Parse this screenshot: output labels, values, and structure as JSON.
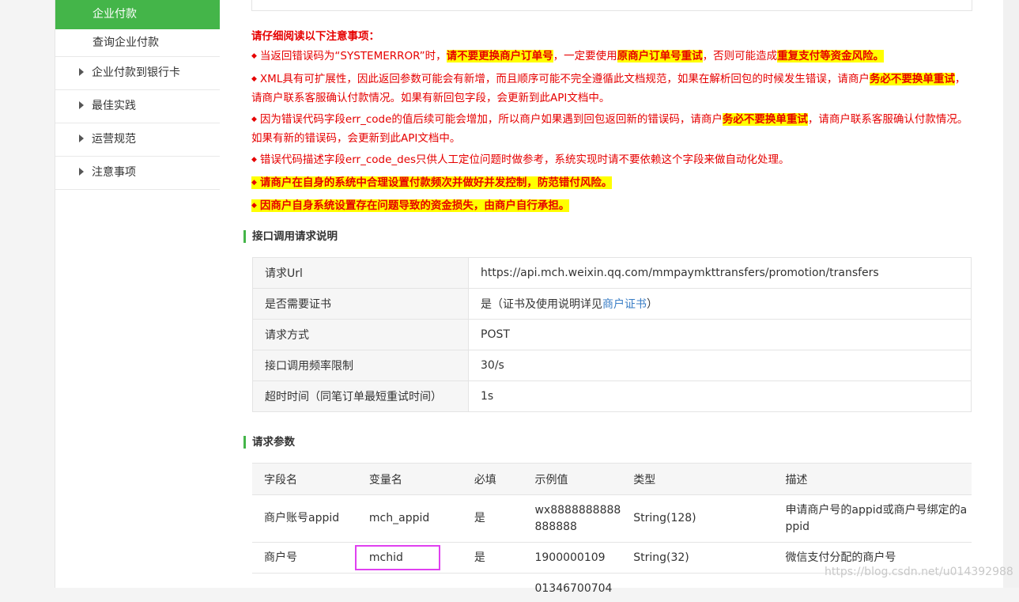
{
  "sidebar": {
    "active": "企业付款",
    "sub": "查询企业付款",
    "items": [
      "企业付款到银行卡",
      "最佳实践",
      "运营规范",
      "注意事项"
    ]
  },
  "notice": {
    "title": "请仔细阅读以下注意事项：",
    "l1": {
      "a": "当返回错误码为“SYSTEMERROR”时，",
      "b": "请不要更换商户订单号",
      "c": "，一定要使用",
      "d": "原商户订单号重试",
      "e": "，否则可能造成",
      "f": "重复支付等资金风险。"
    },
    "l2": {
      "a": "XML具有可扩展性，因此返回参数可能会有新增，而且顺序可能不完全遵循此文档规范，如果在解析回包的时候发生错误，请商户",
      "b": "务必不要换单重试",
      "c": "，请商户联系客服确认付款情况。如果有新回包字段，会更新到此API文档中。"
    },
    "l3": {
      "a": "因为错误代码字段err_code的值后续可能会增加，所以商户如果遇到回包返回新的错误码，请商户",
      "b": "务必不要换单重试",
      "c": "，请商户联系客服确认付款情况。如果有新的错误码，会更新到此API文档中。"
    },
    "l4": "错误代码描述字段err_code_des只供人工定位问题时做参考，系统实现时请不要依赖这个字段来做自动化处理。",
    "l5": "请商户在自身的系统中合理设置付款频次并做好并发控制，防范错付风险。",
    "l6": "因商户自身系统设置存在问题导致的资金损失，由商户自行承担。"
  },
  "req_section": "接口调用请求说明",
  "req_rows": [
    {
      "k": "请求Url",
      "v": "https://api.mch.weixin.qq.com/mmpaymkttransfers/promotion/transfers"
    },
    {
      "k": "是否需要证书",
      "v1": "是（证书及使用说明详见",
      "link": "商户证书",
      "v2": "）"
    },
    {
      "k": "请求方式",
      "v": "POST"
    },
    {
      "k": "接口调用频率限制",
      "v": "30/s"
    },
    {
      "k": "超时时间（同笔订单最短重试时间）",
      "v": "1s"
    }
  ],
  "param_section": "请求参数",
  "param_headers": [
    "字段名",
    "变量名",
    "必填",
    "示例值",
    "类型",
    "描述"
  ],
  "param_rows": [
    [
      "商户账号appid",
      "mch_appid",
      "是",
      "wx8888888888888888",
      "String(128)",
      "申请商户号的appid或商户号绑定的appid"
    ],
    [
      "商户号",
      "mchid",
      "是",
      "1900000109",
      "String(32)",
      "微信支付分配的商户号"
    ]
  ],
  "partial_value": "01346700704",
  "watermark": "https://blog.csdn.net/u014392988",
  "colors": {
    "accent": "#44b549",
    "warning": "#e60000",
    "highlight": "#ffff00",
    "outline": "#e040f0"
  }
}
